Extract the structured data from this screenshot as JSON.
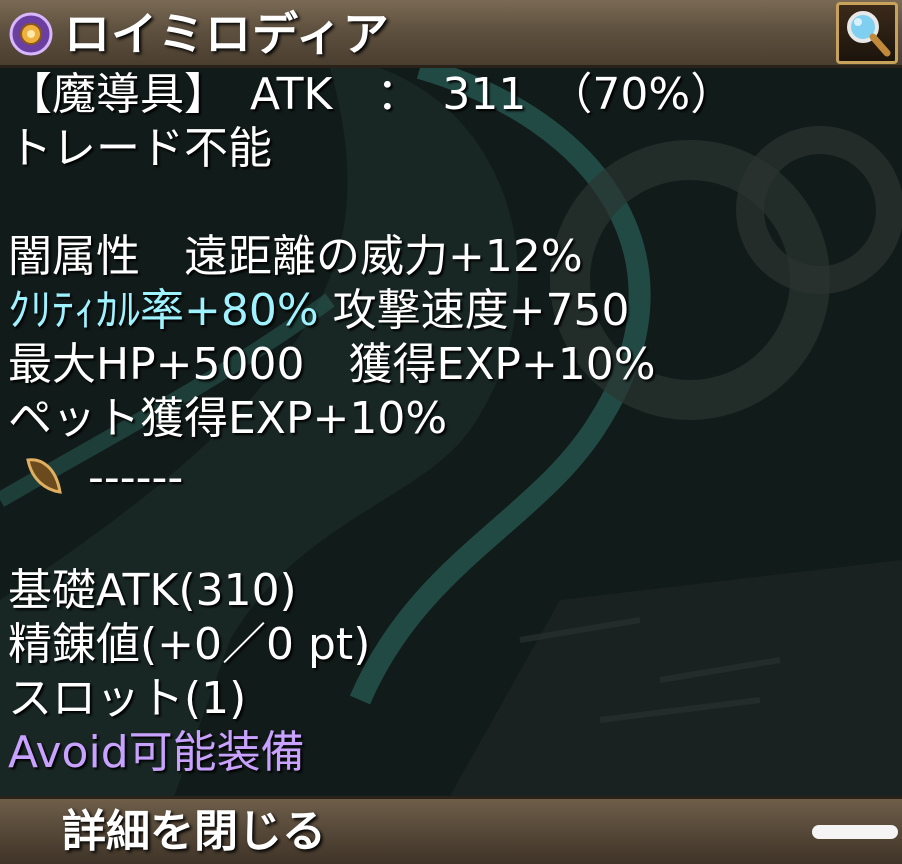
{
  "window": {
    "title": "ロイミロディア",
    "search_icon": "magnifier-icon",
    "title_icon": "orb-icon"
  },
  "item": {
    "category_line": "【魔導具】　ATK　：　311　（70%）",
    "trade_line": "トレード不能",
    "element_line": "闇属性　遠距離の威力+12%",
    "crit_part": "ｸﾘﾃｨｶﾙ率+80%",
    "attack_speed_part": "攻撃速度+750",
    "hp_exp_line": "最大HP+5000　獲得EXP+10%",
    "pet_exp_line": "ペット獲得EXP+10%",
    "card_slot": "------",
    "card_icon": "card-slot-icon",
    "base_atk": "基礎ATK(310)",
    "refine": "精錬値(+0／0 pt)",
    "slots": "スロット(1)",
    "avoid": "Avoid可能装備"
  },
  "footer": {
    "close_label": "詳細を閉じる"
  },
  "colors": {
    "cyan_text": "#9ff2ff",
    "purple_text": "#c9a2ff",
    "title_bar": "#5f513f",
    "search_border": "#c8a25a"
  }
}
